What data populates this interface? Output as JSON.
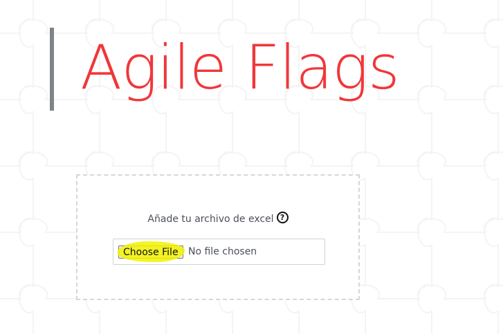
{
  "header": {
    "title": "Agile Flags"
  },
  "upload": {
    "label": "Añade tu archivo de excel",
    "help_icon": "question-circle-icon",
    "choose_button_label": "Choose File",
    "file_status": "No file chosen"
  },
  "colors": {
    "title": "#f0373a",
    "accent_bar": "#7d8586",
    "highlight": "#f2f200"
  }
}
